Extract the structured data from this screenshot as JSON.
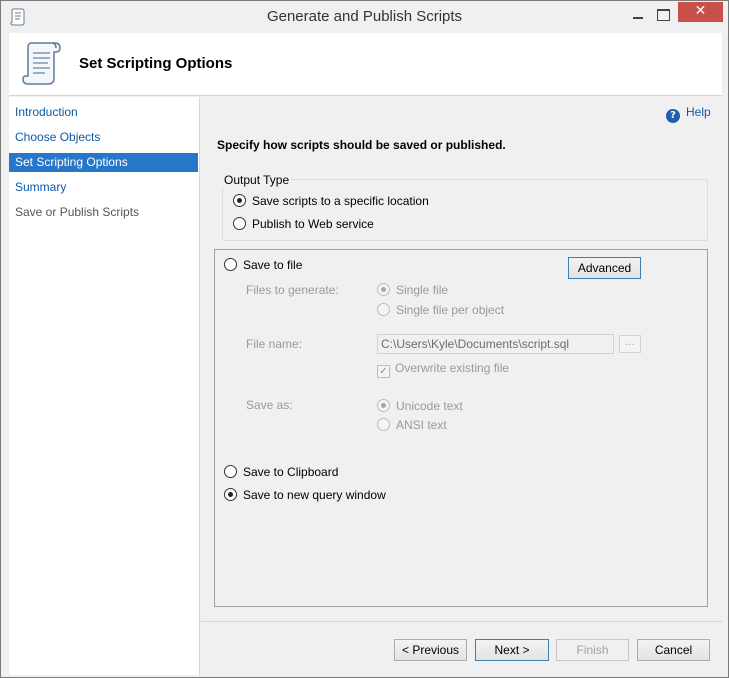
{
  "window": {
    "title": "Generate and Publish Scripts",
    "close_glyph": "✕"
  },
  "header": {
    "title": "Set Scripting Options"
  },
  "sidebar": {
    "items": [
      {
        "label": "Introduction",
        "state": "link"
      },
      {
        "label": "Choose Objects",
        "state": "link"
      },
      {
        "label": "Set Scripting Options",
        "state": "active"
      },
      {
        "label": "Summary",
        "state": "link"
      },
      {
        "label": "Save or Publish Scripts",
        "state": "disabled"
      }
    ]
  },
  "help": {
    "icon": "?",
    "label": "Help"
  },
  "main": {
    "subtitle": "Specify how scripts should be saved or published.",
    "output_type": {
      "legend": "Output Type",
      "options": [
        {
          "label": "Save scripts to a specific location",
          "checked": true
        },
        {
          "label": "Publish to Web service",
          "checked": false
        }
      ]
    },
    "save_to_file": {
      "label": "Save to file",
      "checked": false
    },
    "advanced_label": "Advanced",
    "files_to_generate": {
      "label": "Files to generate:",
      "options": [
        {
          "label": "Single file",
          "checked": true
        },
        {
          "label": "Single file per object",
          "checked": false
        }
      ]
    },
    "file_name": {
      "label": "File name:",
      "value": "C:\\Users\\Kyle\\Documents\\script.sql",
      "browse_label": "..."
    },
    "overwrite": {
      "label": "Overwrite existing file",
      "checked": true,
      "check_glyph": "✓"
    },
    "save_as": {
      "label": "Save as:",
      "options": [
        {
          "label": "Unicode text",
          "checked": true
        },
        {
          "label": "ANSI text",
          "checked": false
        }
      ]
    },
    "save_to_clipboard": {
      "label": "Save to Clipboard",
      "checked": false
    },
    "save_to_query_window": {
      "label": "Save to new query window",
      "checked": true
    }
  },
  "footer": {
    "previous_label": "< Previous",
    "next_label": "Next >",
    "finish_label": "Finish",
    "cancel_label": "Cancel"
  },
  "colors": {
    "accent": "#2677c9",
    "link": "#0b5aa6",
    "close": "#c7504b"
  }
}
